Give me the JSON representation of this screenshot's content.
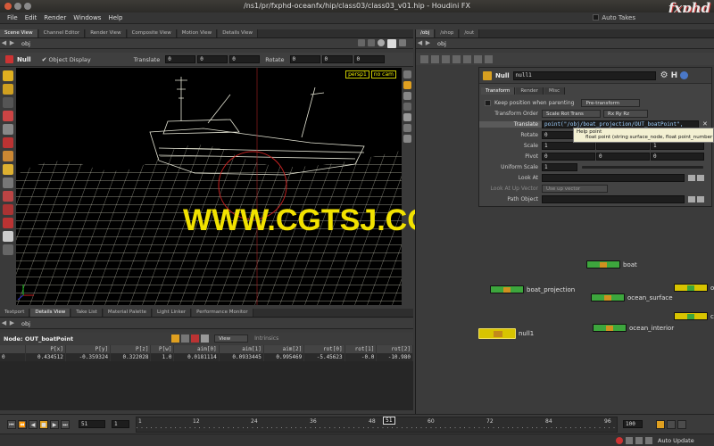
{
  "window": {
    "title": "/ns1/pr/fxphd-oceanfx/hip/class03/class03_v01.hip - Houdini FX",
    "logo": "fxphd"
  },
  "menu": [
    "File",
    "Edit",
    "Render",
    "Windows",
    "Help"
  ],
  "auto_takes": "Auto Takes",
  "left_tabs": [
    "Scene View",
    "Channel Editor",
    "Render View",
    "Composite View",
    "Motion View",
    "Details View"
  ],
  "left_path": "obj",
  "toolbar": {
    "node_type": "Null",
    "object_display": "Object Display",
    "translate_label": "Translate",
    "translate": [
      "0",
      "0",
      "0"
    ],
    "rotate_label": "Rotate",
    "rotate": [
      "0",
      "0",
      "0"
    ]
  },
  "viewport": {
    "camera": "persp1",
    "cam_menu": "no cam"
  },
  "watermark": "WWW.CGTSJ.COM",
  "bottom_tabs": [
    "Textport",
    "Details View",
    "Take List",
    "Material Palette",
    "Light Linker",
    "Performance Monitor"
  ],
  "bottom_path": "obj",
  "details": {
    "node_label": "Node: OUT_boatPoint",
    "view_menu": "View",
    "intrinsics": "Intrinsics",
    "columns": [
      "",
      "P[x]",
      "P[y]",
      "P[z]",
      "P[w]",
      "aim[0]",
      "aim[1]",
      "aim[2]",
      "rot[0]",
      "rot[1]",
      "rot[2]"
    ],
    "rows": [
      [
        "0",
        "0.434512",
        "-0.359324",
        "0.322028",
        "1.0",
        "0.0181114",
        "0.0933445",
        "0.995469",
        "-5.45623",
        "-0.0",
        "-10.980"
      ]
    ]
  },
  "right_tabs": [
    "/obj",
    "/shop",
    "/out"
  ],
  "right_path": "obj",
  "params": {
    "node_type": "Null",
    "node_name": "null1",
    "tabs": [
      "Transform",
      "Render",
      "Misc"
    ],
    "keep_position": "Keep position when parenting",
    "pre_transform": "Pre-transform",
    "transform_order_label": "Transform Order",
    "transform_order": "Scale Rot Trans",
    "rot_order": "Rx Ry Rz",
    "translate_label": "Translate",
    "translate_expr": "point(\"/obj/boat_projection/OUT_boatPoint\", ",
    "rotate_label": "Rotate",
    "rotate": [
      "0",
      "",
      ""
    ],
    "scale_label": "Scale",
    "scale": [
      "1",
      "",
      "1"
    ],
    "pivot_label": "Pivot",
    "pivot": [
      "0",
      "0",
      "0"
    ],
    "uniform_scale_label": "Uniform Scale",
    "uniform_scale": "1",
    "look_at_label": "Look At",
    "look_at_up_label": "Look At Up Vector",
    "look_at_up": "Use up vector",
    "path_object_label": "Path Object",
    "help_title": "Help  point",
    "help_sig": "float point (string surface_node, float point_number"
  },
  "nodes": [
    {
      "name": "boat",
      "color": "#3da63d"
    },
    {
      "name": "boat_projection",
      "color": "#3da63d"
    },
    {
      "name": "ocean_surface",
      "color": "#3da63d"
    },
    {
      "name": "ocean_interior",
      "color": "#3da63d"
    },
    {
      "name": "null1",
      "color": "#d8c400"
    },
    {
      "name": "o",
      "color": "#d8c400"
    },
    {
      "name": "c",
      "color": "#d8c400"
    }
  ],
  "timeline": {
    "current_frame": "51",
    "start": "1",
    "end": "100",
    "ticks": [
      "1",
      "12",
      "24",
      "36",
      "48",
      "60",
      "72",
      "84",
      "96"
    ],
    "frame_marker": "51"
  },
  "status": {
    "auto_update": "Auto Update"
  }
}
